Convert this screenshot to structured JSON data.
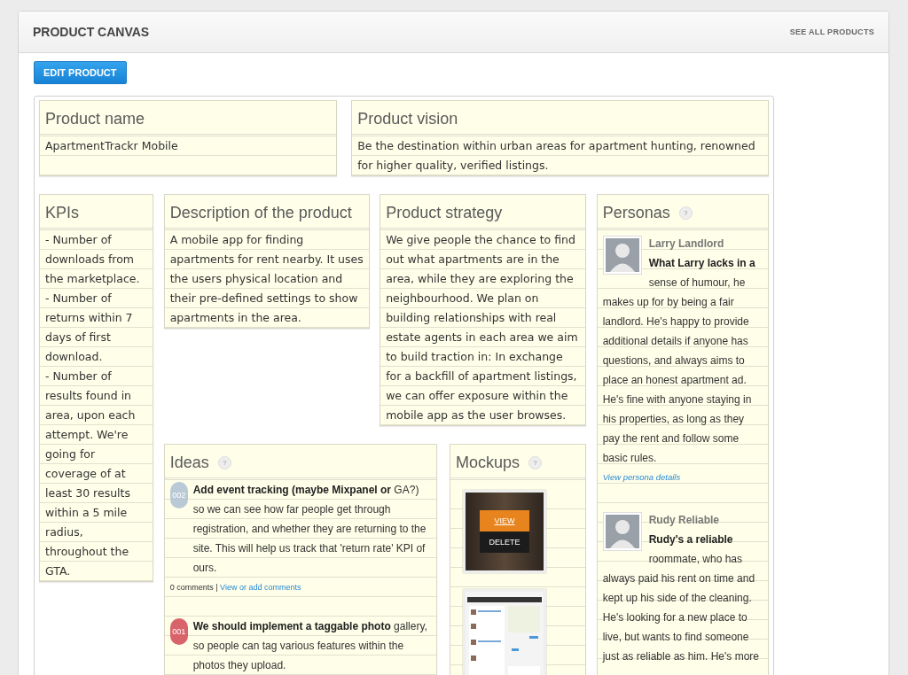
{
  "header": {
    "title": "PRODUCT CANVAS",
    "link": "SEE ALL PRODUCTS"
  },
  "edit_button": "EDIT PRODUCT",
  "product_name": {
    "title": "Product name",
    "text": "ApartmentTrackr Mobile"
  },
  "product_vision": {
    "title": "Product vision",
    "text": "Be the destination within urban areas for apartment hunting, renowned for higher quality, verified listings."
  },
  "kpis": {
    "title": "KPIs",
    "lines": [
      "- Number of downloads from the marketplace.",
      "- Number of returns within 7 days of first download.",
      "- Number of results found in area, upon each attempt.  We're going for coverage of at least 30 results within a 5 mile radius, throughout the GTA."
    ]
  },
  "description": {
    "title": "Description of the product",
    "text": "A mobile app for finding apartments for rent nearby.  It uses the users physical location and their pre-defined settings to show apartments in the area."
  },
  "strategy": {
    "title": "Product strategy",
    "text": "We give people the chance to find out what apartments are in the area, while they are exploring the neighbourhood.  We plan on building relationships with real estate agents in each area we aim to build traction in: In exchange for a backfill of apartment listings, we can offer exposure within the mobile app as the user browses."
  },
  "ideas": {
    "title": "Ideas",
    "help": "?",
    "items": [
      {
        "number": "002",
        "color": "#b9c9d6",
        "text": "**Add event tracking (maybe Mixpanel or** GA?) so we can see how far people get through registration, and whether they are returning to the site. This will help us track that 'return rate' KPI of ours.",
        "comments": "0 comments",
        "separator": "|",
        "comments_link": "View or add comments"
      },
      {
        "number": "001",
        "color": "#d9636b",
        "text": "**We should implement a taggable photo** gallery, so people can tag various features within the photos they upload."
      }
    ]
  },
  "mockups": {
    "title": "Mockups",
    "help": "?",
    "items": [
      {
        "kind": "buttons",
        "view": "VIEW",
        "delete": "DELETE"
      },
      {
        "kind": "picture"
      }
    ]
  },
  "personas": {
    "title": "Personas",
    "help": "?",
    "items": [
      {
        "name": "Larry Landlord",
        "text": "**What Larry lacks in a** sense of humour, he makes up for by being a fair landlord. He's happy to provide additional details if anyone has questions, and always aims to place an honest apartment ad. He's fine with anyone staying in his properties, as long as they pay the rent and follow some basic rules.",
        "link": "View persona details"
      },
      {
        "name": "Rudy Reliable",
        "text": "**Rudy's a reliable** roommate, who has always paid his rent on time and kept up his side of the cleaning. He's looking for a new place to live, but wants to find someone just as reliable as him. He's more"
      }
    ]
  }
}
